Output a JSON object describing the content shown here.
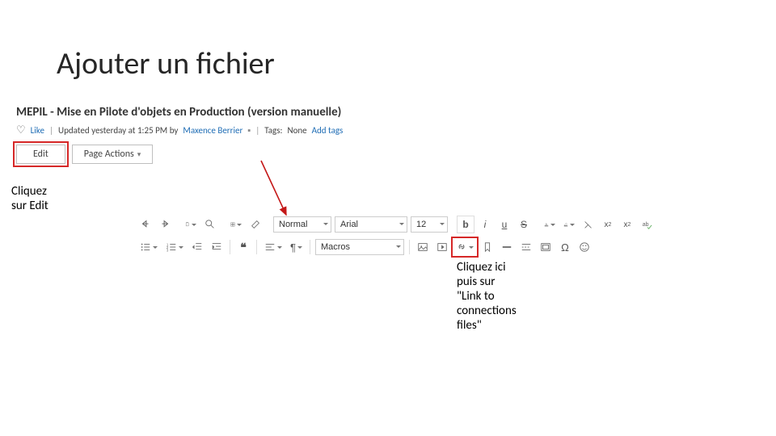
{
  "slide": {
    "title": "Ajouter un fichier",
    "callout_left_l1": "Cliquez",
    "callout_left_l2": "sur Edit",
    "callout_right_l1": "Cliquez ici",
    "callout_right_l2": "puis sur",
    "callout_right_l3": "\"Link to",
    "callout_right_l4": "connections",
    "callout_right_l5": "files\""
  },
  "wiki": {
    "title": "MEPIL - Mise en Pilote d'objets en Production (version manuelle)",
    "like": "Like",
    "updated": "Updated yesterday at 1:25 PM by",
    "author": "Maxence Berrier",
    "tags_label": "Tags:",
    "tags_none": "None",
    "add_tags": "Add tags",
    "edit": "Edit",
    "page_actions": "Page Actions"
  },
  "toolbar": {
    "style": "Normal",
    "font": "Arial",
    "size": "12",
    "macros": "Macros",
    "bold": "b",
    "italic": "i",
    "underline": "u",
    "strike": "S"
  }
}
